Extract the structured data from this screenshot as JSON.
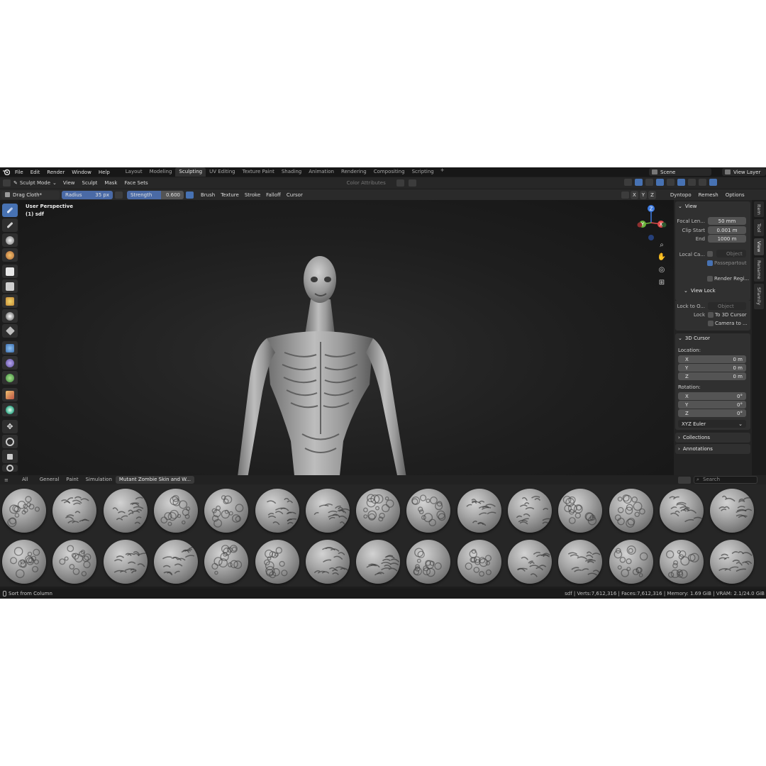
{
  "menu": [
    "File",
    "Edit",
    "Render",
    "Window",
    "Help"
  ],
  "workspaces": [
    "Layout",
    "Modeling",
    "Sculpting",
    "UV Editing",
    "Texture Paint",
    "Shading",
    "Animation",
    "Rendering",
    "Compositing",
    "Scripting"
  ],
  "active_workspace": "Sculpting",
  "add_workspace": "+",
  "scene": "Scene",
  "view_layer": "View Layer",
  "header": {
    "mode": "Sculpt Mode",
    "menus": [
      "View",
      "Sculpt",
      "Mask",
      "Face Sets"
    ],
    "color_attributes": "Color Attributes"
  },
  "tool_settings": {
    "brush": "Drag Cloth*",
    "radius_label": "Radius",
    "radius_value": "35 px",
    "strength_label": "Strength",
    "strength_value": "0.600",
    "dropdowns": [
      "Brush",
      "Texture",
      "Stroke",
      "Falloff",
      "Cursor"
    ],
    "axes": [
      "X",
      "Y",
      "Z"
    ],
    "right_dropdowns": [
      "Dyntopo",
      "Remesh",
      "Options"
    ]
  },
  "viewport": {
    "perspective": "User Perspective",
    "object": "(1) sdf"
  },
  "gizmo": {
    "z": "Z",
    "y": "Y",
    "x": "X"
  },
  "npanel": {
    "view_title": "View",
    "focal_label": "Focal Len...",
    "focal_value": "50 mm",
    "clip_start_label": "Clip Start",
    "clip_start_value": "0.001 m",
    "end_label": "End",
    "end_value": "1000 m",
    "local_camera_label": "Local Ca...",
    "local_camera_placeholder": "Object",
    "passepartout": "Passepartout",
    "render_region": "Render Regi...",
    "view_lock_title": "View Lock",
    "lock_to_label": "Lock to O...",
    "lock_to_placeholder": "Object",
    "lock_label": "Lock",
    "to_3d_cursor": "To 3D Cursor",
    "camera_to": "Camera to ...",
    "cursor_title": "3D Cursor",
    "location_label": "Location:",
    "loc": [
      {
        "axis": "X",
        "value": "0 m"
      },
      {
        "axis": "Y",
        "value": "0 m"
      },
      {
        "axis": "Z",
        "value": "0 m"
      }
    ],
    "rotation_label": "Rotation:",
    "rot": [
      {
        "axis": "X",
        "value": "0°"
      },
      {
        "axis": "Y",
        "value": "0°"
      },
      {
        "axis": "Z",
        "value": "0°"
      }
    ],
    "rotation_mode": "XYZ Euler",
    "collections": "Collections",
    "annotations": "Annotations"
  },
  "side_tabs": [
    "Item",
    "Tool",
    "View",
    "Rename",
    "SFamily"
  ],
  "active_side_tab": "View",
  "asset_tabs": [
    "All",
    "General",
    "Paint",
    "Simulation",
    "Mutant Zombie Skin and W..."
  ],
  "active_asset_tab": "Mutant Zombie Skin and W...",
  "asset_search_placeholder": "Search",
  "status": {
    "left": "Sort from Column",
    "right": "sdf | Verts:7,612,316 | Faces:7,612,316 | Memory: 1.69 GiB | VRAM: 2.1/24.0 GiB"
  },
  "colors": {
    "accent": "#4772b3",
    "gizmo_x": "#e04a4a",
    "gizmo_y": "#6bb33a",
    "gizmo_z": "#3e7be0"
  }
}
